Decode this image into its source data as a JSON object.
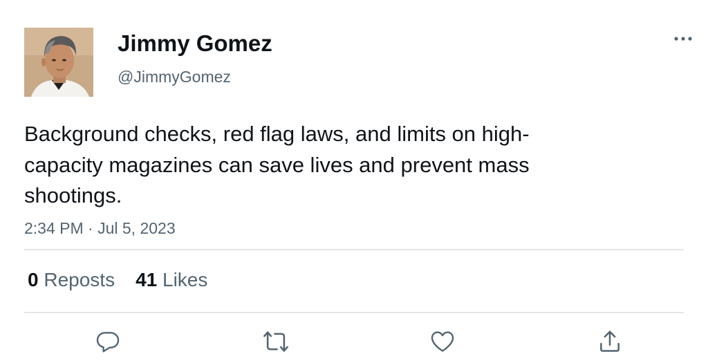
{
  "tweet": {
    "author": {
      "display_name": "Jimmy Gomez",
      "handle": "@JimmyGomez"
    },
    "text_lines": [
      "Background checks, red flag laws, and limits on high-",
      "capacity magazines can save lives and prevent mass",
      "shootings."
    ],
    "timestamp": "2:34 PM · Jul 5, 2023",
    "stats": {
      "reposts_count": "0",
      "reposts_label": "Reposts",
      "likes_count": "41",
      "likes_label": "Likes"
    },
    "actions": [
      {
        "icon": "reply-icon"
      },
      {
        "icon": "repost-icon"
      },
      {
        "icon": "heart-icon"
      },
      {
        "icon": "share-icon"
      }
    ],
    "more_icon": "more-icon"
  },
  "colors": {
    "text_primary": "#0f1419",
    "text_secondary": "#536471",
    "divider": "#e3e6e8",
    "icon": "#536471"
  }
}
